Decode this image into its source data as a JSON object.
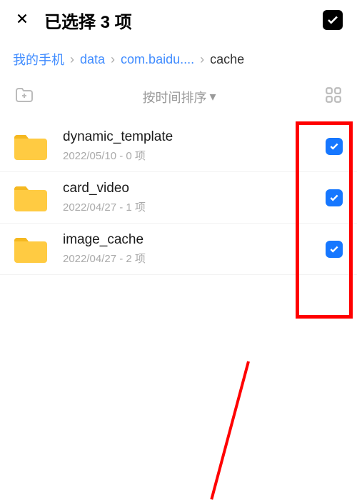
{
  "header": {
    "title": "已选择 3 项"
  },
  "breadcrumb": {
    "items": [
      "我的手机",
      "data",
      "com.baidu....",
      "cache"
    ]
  },
  "toolbar": {
    "sort_label": "按时间排序"
  },
  "files": [
    {
      "name": "dynamic_template",
      "meta": "2022/05/10 - 0 项",
      "checked": true
    },
    {
      "name": "card_video",
      "meta": "2022/04/27 - 1 项",
      "checked": true
    },
    {
      "name": "image_cache",
      "meta": "2022/04/27 - 2 项",
      "checked": true
    }
  ]
}
